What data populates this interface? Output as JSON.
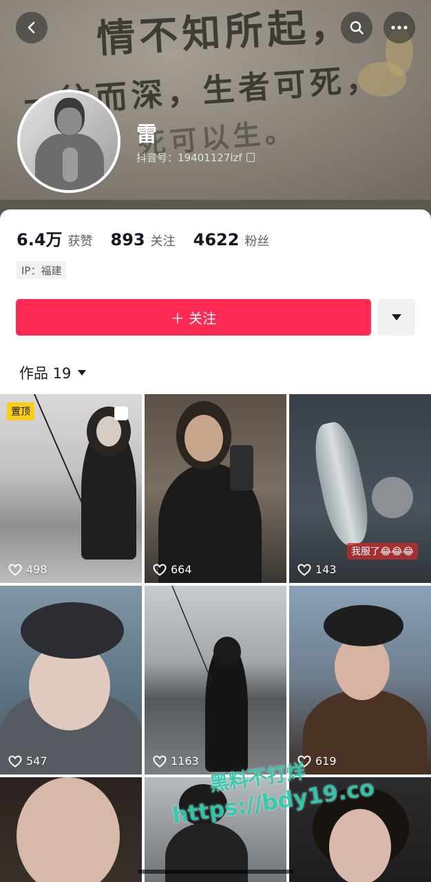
{
  "header": {
    "banner_text_line1": "情不知所起，",
    "banner_text_line2": "一往而深，生者可死，",
    "banner_text_line3": "死可以生。",
    "nickname": "雷",
    "douyin_id": "抖音号：19401127lzf",
    "back_icon": "chevron-left-icon",
    "search_icon": "search-icon",
    "more_icon": "more-horizontal-icon"
  },
  "stats": [
    {
      "value": "6.4万",
      "label": "获赞"
    },
    {
      "value": "893",
      "label": "关注"
    },
    {
      "value": "4622",
      "label": "粉丝"
    }
  ],
  "ip_tag": "IP：福建",
  "actions": {
    "follow_label": "＋ 关注",
    "dropdown_icon": "triangle-down-icon"
  },
  "works_tab": {
    "label": "作品 19"
  },
  "videos": [
    {
      "likes": "498",
      "pinned_label": "置顶"
    },
    {
      "likes": "664"
    },
    {
      "likes": "143",
      "overlay_text": "我服了😂😂😂"
    },
    {
      "likes": "547"
    },
    {
      "likes": "1163"
    },
    {
      "likes": "619"
    },
    {
      "likes": ""
    },
    {
      "likes": ""
    },
    {
      "likes": ""
    }
  ],
  "watermark": {
    "line1": "黑料不打烊",
    "line2": "https://bdy19.co"
  },
  "colors": {
    "accent": "#fe2c55",
    "pin": "#face15"
  }
}
